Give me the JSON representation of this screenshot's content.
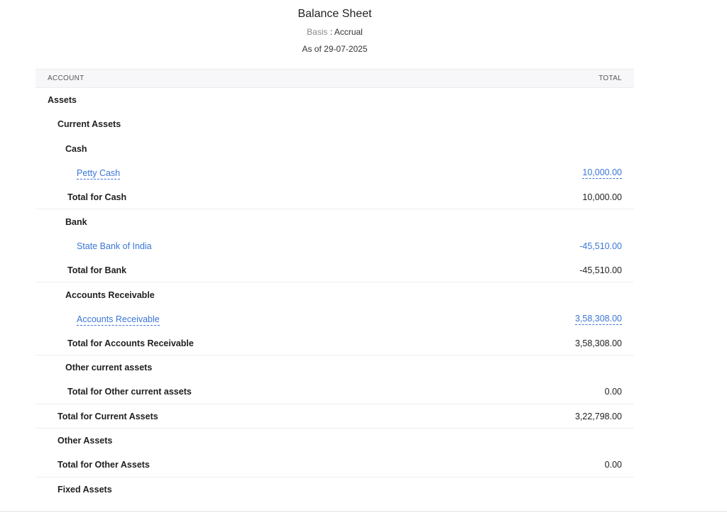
{
  "report": {
    "title": "Balance Sheet",
    "basis_label": "Basis",
    "basis_sep": " : ",
    "basis_value": "Accrual",
    "as_of": "As of 29-07-2025"
  },
  "table": {
    "col_account": "ACCOUNT",
    "col_total": "TOTAL",
    "rows": {
      "assets": {
        "name": "Assets"
      },
      "current_assets": {
        "name": "Current Assets"
      },
      "cash": {
        "name": "Cash"
      },
      "petty_cash": {
        "name": "Petty Cash",
        "amount": "10,000.00"
      },
      "total_cash": {
        "name": "Total for Cash",
        "amount": "10,000.00"
      },
      "bank": {
        "name": "Bank"
      },
      "sbi": {
        "name": "State Bank of India",
        "amount": "-45,510.00"
      },
      "total_bank": {
        "name": "Total for Bank",
        "amount": "-45,510.00"
      },
      "ar": {
        "name": "Accounts Receivable"
      },
      "ar_item": {
        "name": "Accounts Receivable",
        "amount": "3,58,308.00"
      },
      "total_ar": {
        "name": "Total for Accounts Receivable",
        "amount": "3,58,308.00"
      },
      "other_current": {
        "name": "Other current assets"
      },
      "total_other_current": {
        "name": "Total for Other current assets",
        "amount": "0.00"
      },
      "total_current_assets": {
        "name": "Total for Current Assets",
        "amount": "3,22,798.00"
      },
      "other_assets": {
        "name": "Other Assets"
      },
      "total_other_assets": {
        "name": "Total for Other Assets",
        "amount": "0.00"
      },
      "fixed_assets": {
        "name": "Fixed Assets"
      }
    }
  },
  "colors": {
    "link": "#3a76d6",
    "header_bg": "#f7f7fa"
  }
}
